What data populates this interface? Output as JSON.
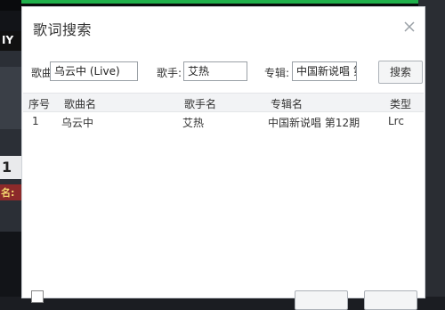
{
  "dialog": {
    "title": "歌词搜索"
  },
  "form": {
    "song_label": "歌曲:",
    "song_value": "乌云中 (Live)",
    "artist_label": "歌手:",
    "artist_value": "艾热",
    "album_label": "专辑:",
    "album_value": "中国新说唱 第",
    "search_button": "搜索"
  },
  "table": {
    "headers": [
      "序号",
      "歌曲名",
      "歌手名",
      "专辑名",
      "类型"
    ],
    "rows": [
      [
        "1",
        "乌云中",
        "艾热",
        "中国新说唱 第12期",
        "Lrc"
      ]
    ]
  },
  "background": {
    "left_badge": "IY",
    "left_text_1": "名:",
    "left_text_2": "1"
  },
  "colors": {
    "accent_green": "#20b04b"
  }
}
